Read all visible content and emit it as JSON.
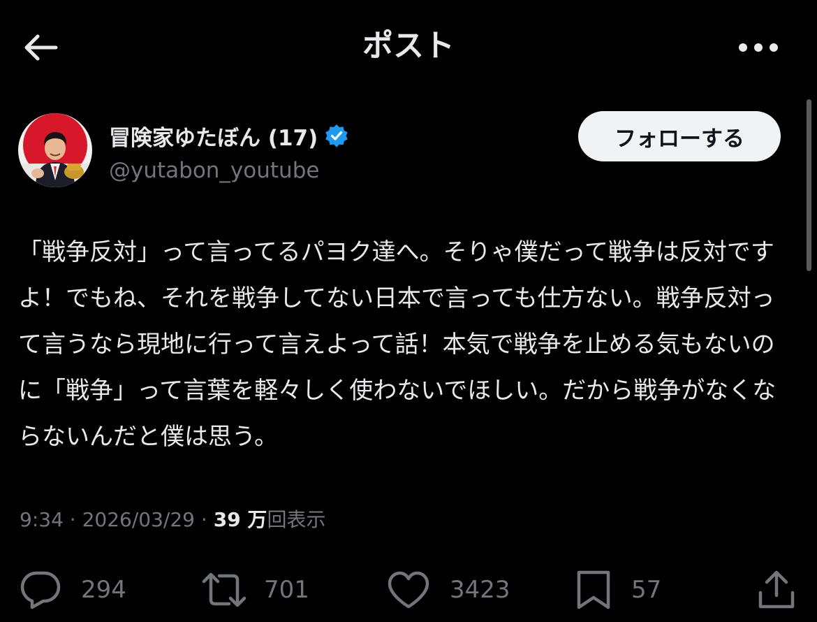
{
  "header": {
    "title": "ポスト",
    "back_icon": "arrow-left-icon",
    "more_icon": "more-horizontal-icon"
  },
  "author": {
    "display_name": "冒険家ゆたぼん (17)",
    "handle": "@yutabon_youtube",
    "verified_icon": "verified-badge-icon",
    "verified_color": "#1d9bf0"
  },
  "follow_button": {
    "label": "フォローする"
  },
  "post": {
    "text": "「戦争反対」って言ってるパヨク達へ。そりゃ僕だって戦争は反対ですよ！でもね、それを戦争してない日本で言っても仕方ない。戦争反対って言うなら現地に行って言えよって話！本気で戦争を止める気もないのに「戦争」って言葉を軽々しく使わないでほしい。だから戦争がなくならないんだと僕は思う。"
  },
  "meta": {
    "time": "9:34",
    "separator": "·",
    "date": "2026/03/29",
    "views_count": "39 万",
    "views_label": "回表示"
  },
  "actions": {
    "reply": {
      "icon": "reply-icon",
      "count": "294"
    },
    "repost": {
      "icon": "repost-icon",
      "count": "701"
    },
    "like": {
      "icon": "heart-icon",
      "count": "3423"
    },
    "bookmark": {
      "icon": "bookmark-icon",
      "count": "57"
    },
    "share": {
      "icon": "share-icon"
    }
  },
  "colors": {
    "background": "#000000",
    "text_primary": "#e7e9ea",
    "text_secondary": "#71767b",
    "button_bg": "#eff3f4"
  }
}
